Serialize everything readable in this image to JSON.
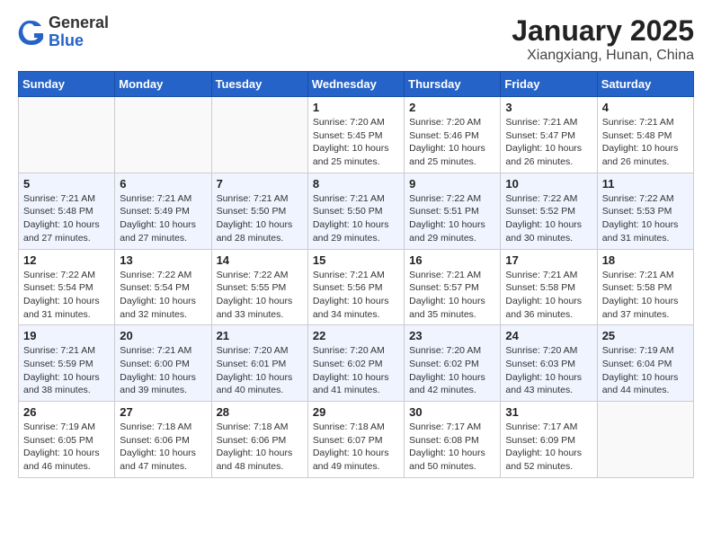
{
  "header": {
    "logo": {
      "general": "General",
      "blue": "Blue"
    },
    "title": "January 2025",
    "subtitle": "Xiangxiang, Hunan, China"
  },
  "weekdays": [
    "Sunday",
    "Monday",
    "Tuesday",
    "Wednesday",
    "Thursday",
    "Friday",
    "Saturday"
  ],
  "weeks": [
    [
      {
        "day": "",
        "info": ""
      },
      {
        "day": "",
        "info": ""
      },
      {
        "day": "",
        "info": ""
      },
      {
        "day": "1",
        "info": "Sunrise: 7:20 AM\nSunset: 5:45 PM\nDaylight: 10 hours\nand 25 minutes."
      },
      {
        "day": "2",
        "info": "Sunrise: 7:20 AM\nSunset: 5:46 PM\nDaylight: 10 hours\nand 25 minutes."
      },
      {
        "day": "3",
        "info": "Sunrise: 7:21 AM\nSunset: 5:47 PM\nDaylight: 10 hours\nand 26 minutes."
      },
      {
        "day": "4",
        "info": "Sunrise: 7:21 AM\nSunset: 5:48 PM\nDaylight: 10 hours\nand 26 minutes."
      }
    ],
    [
      {
        "day": "5",
        "info": "Sunrise: 7:21 AM\nSunset: 5:48 PM\nDaylight: 10 hours\nand 27 minutes."
      },
      {
        "day": "6",
        "info": "Sunrise: 7:21 AM\nSunset: 5:49 PM\nDaylight: 10 hours\nand 27 minutes."
      },
      {
        "day": "7",
        "info": "Sunrise: 7:21 AM\nSunset: 5:50 PM\nDaylight: 10 hours\nand 28 minutes."
      },
      {
        "day": "8",
        "info": "Sunrise: 7:21 AM\nSunset: 5:50 PM\nDaylight: 10 hours\nand 29 minutes."
      },
      {
        "day": "9",
        "info": "Sunrise: 7:22 AM\nSunset: 5:51 PM\nDaylight: 10 hours\nand 29 minutes."
      },
      {
        "day": "10",
        "info": "Sunrise: 7:22 AM\nSunset: 5:52 PM\nDaylight: 10 hours\nand 30 minutes."
      },
      {
        "day": "11",
        "info": "Sunrise: 7:22 AM\nSunset: 5:53 PM\nDaylight: 10 hours\nand 31 minutes."
      }
    ],
    [
      {
        "day": "12",
        "info": "Sunrise: 7:22 AM\nSunset: 5:54 PM\nDaylight: 10 hours\nand 31 minutes."
      },
      {
        "day": "13",
        "info": "Sunrise: 7:22 AM\nSunset: 5:54 PM\nDaylight: 10 hours\nand 32 minutes."
      },
      {
        "day": "14",
        "info": "Sunrise: 7:22 AM\nSunset: 5:55 PM\nDaylight: 10 hours\nand 33 minutes."
      },
      {
        "day": "15",
        "info": "Sunrise: 7:21 AM\nSunset: 5:56 PM\nDaylight: 10 hours\nand 34 minutes."
      },
      {
        "day": "16",
        "info": "Sunrise: 7:21 AM\nSunset: 5:57 PM\nDaylight: 10 hours\nand 35 minutes."
      },
      {
        "day": "17",
        "info": "Sunrise: 7:21 AM\nSunset: 5:58 PM\nDaylight: 10 hours\nand 36 minutes."
      },
      {
        "day": "18",
        "info": "Sunrise: 7:21 AM\nSunset: 5:58 PM\nDaylight: 10 hours\nand 37 minutes."
      }
    ],
    [
      {
        "day": "19",
        "info": "Sunrise: 7:21 AM\nSunset: 5:59 PM\nDaylight: 10 hours\nand 38 minutes."
      },
      {
        "day": "20",
        "info": "Sunrise: 7:21 AM\nSunset: 6:00 PM\nDaylight: 10 hours\nand 39 minutes."
      },
      {
        "day": "21",
        "info": "Sunrise: 7:20 AM\nSunset: 6:01 PM\nDaylight: 10 hours\nand 40 minutes."
      },
      {
        "day": "22",
        "info": "Sunrise: 7:20 AM\nSunset: 6:02 PM\nDaylight: 10 hours\nand 41 minutes."
      },
      {
        "day": "23",
        "info": "Sunrise: 7:20 AM\nSunset: 6:02 PM\nDaylight: 10 hours\nand 42 minutes."
      },
      {
        "day": "24",
        "info": "Sunrise: 7:20 AM\nSunset: 6:03 PM\nDaylight: 10 hours\nand 43 minutes."
      },
      {
        "day": "25",
        "info": "Sunrise: 7:19 AM\nSunset: 6:04 PM\nDaylight: 10 hours\nand 44 minutes."
      }
    ],
    [
      {
        "day": "26",
        "info": "Sunrise: 7:19 AM\nSunset: 6:05 PM\nDaylight: 10 hours\nand 46 minutes."
      },
      {
        "day": "27",
        "info": "Sunrise: 7:18 AM\nSunset: 6:06 PM\nDaylight: 10 hours\nand 47 minutes."
      },
      {
        "day": "28",
        "info": "Sunrise: 7:18 AM\nSunset: 6:06 PM\nDaylight: 10 hours\nand 48 minutes."
      },
      {
        "day": "29",
        "info": "Sunrise: 7:18 AM\nSunset: 6:07 PM\nDaylight: 10 hours\nand 49 minutes."
      },
      {
        "day": "30",
        "info": "Sunrise: 7:17 AM\nSunset: 6:08 PM\nDaylight: 10 hours\nand 50 minutes."
      },
      {
        "day": "31",
        "info": "Sunrise: 7:17 AM\nSunset: 6:09 PM\nDaylight: 10 hours\nand 52 minutes."
      },
      {
        "day": "",
        "info": ""
      }
    ]
  ]
}
